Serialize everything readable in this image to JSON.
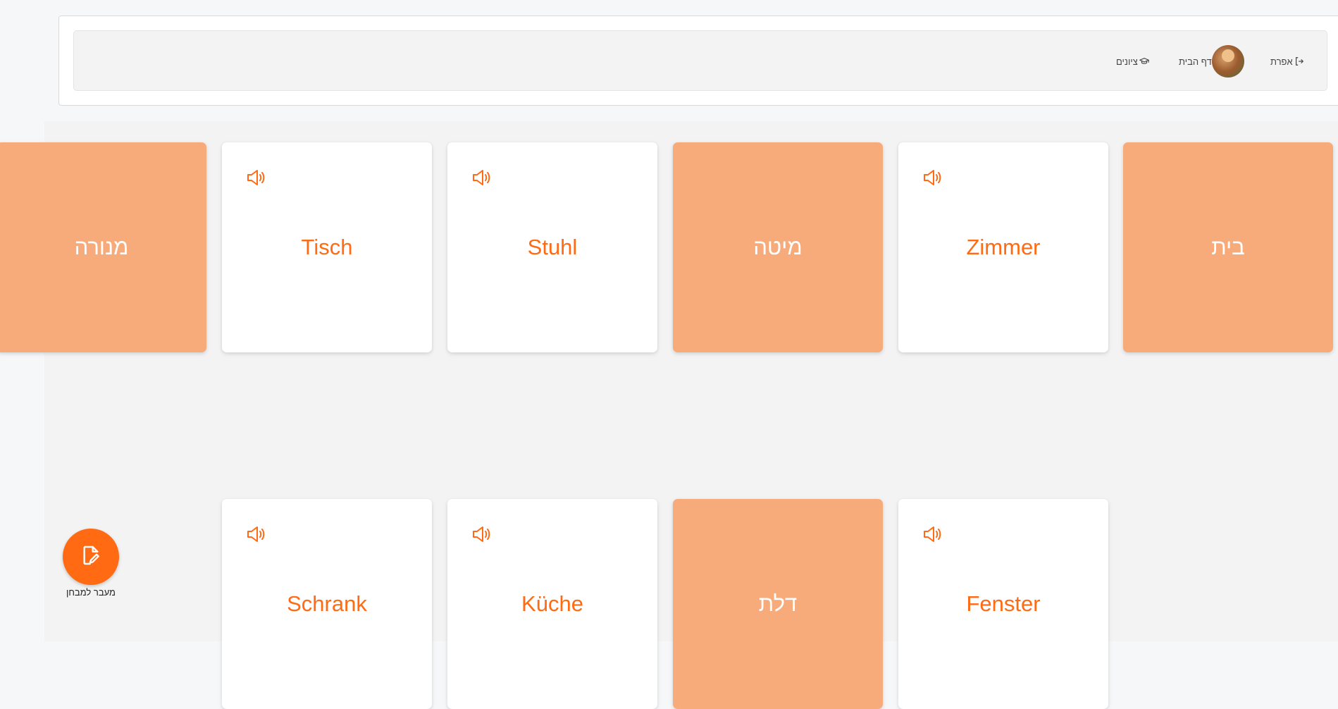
{
  "header": {
    "logout_label": "אפרת",
    "home_label": "דף הבית",
    "grades_label": "ציונים"
  },
  "cards": [
    {
      "word": "בית",
      "lang": "he",
      "has_sound": false
    },
    {
      "word": "Zimmer",
      "lang": "de",
      "has_sound": true
    },
    {
      "word": "מיטה",
      "lang": "he",
      "has_sound": false
    },
    {
      "word": "Stuhl",
      "lang": "de",
      "has_sound": true
    },
    {
      "word": "Tisch",
      "lang": "de",
      "has_sound": true
    },
    {
      "word": "מנורה",
      "lang": "he",
      "has_sound": false
    },
    {
      "word": "Fenster",
      "lang": "de",
      "has_sound": true
    },
    {
      "word": "דלת",
      "lang": "he",
      "has_sound": false
    },
    {
      "word": "Küche",
      "lang": "de",
      "has_sound": true
    },
    {
      "word": "Schrank",
      "lang": "de",
      "has_sound": true
    }
  ],
  "fab": {
    "label": "מעבר למבחן",
    "icon": "file-edit-icon"
  },
  "colors": {
    "accent": "#ff6a13",
    "hebrew_card": "#f8ab7a",
    "german_card": "#ffffff"
  }
}
